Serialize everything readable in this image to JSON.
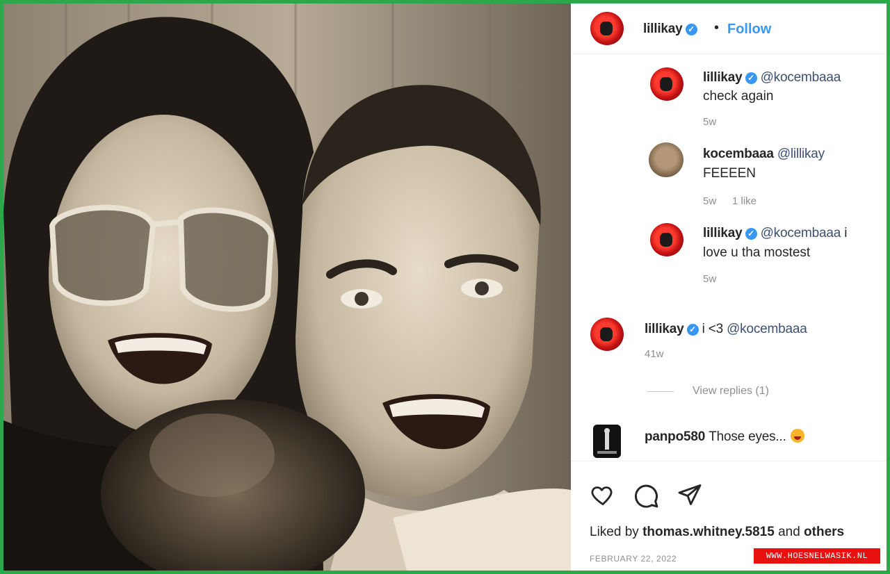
{
  "header": {
    "username": "lillikay",
    "separator": "•",
    "follow_label": "Follow"
  },
  "comments": [
    {
      "username": "lillikay",
      "verified": true,
      "mention": "@kocembaaa",
      "text": "check again",
      "time": "5w",
      "likes": ""
    },
    {
      "username": "kocembaaa",
      "verified": false,
      "mention": "@lillikay",
      "text": "FEEEEN",
      "time": "5w",
      "likes": "1 like"
    },
    {
      "username": "lillikay",
      "verified": true,
      "mention": "@kocembaaa",
      "text_line1_suffix": "i",
      "text": "love u tha mostest",
      "time": "5w",
      "likes": ""
    }
  ],
  "main_comment": {
    "username": "lillikay",
    "verified": true,
    "text": "i <3",
    "mention": "@kocembaaa",
    "time": "41w"
  },
  "view_replies": "View replies (1)",
  "last_comment": {
    "username": "panpo580",
    "text": "Those eyes..."
  },
  "actions": {
    "like_icon": "heart-icon",
    "comment_icon": "comment-icon",
    "share_icon": "share-icon"
  },
  "likes": {
    "prefix": "Liked by",
    "user": "thomas.whitney.5815",
    "middle": "and",
    "suffix": "others"
  },
  "date": "FEBRUARY 22, 2022",
  "watermark": "WWW.HOESNELWASIK.NL",
  "colors": {
    "border": "#2aa84a",
    "accent": "#3897f0",
    "watermark_bg": "#e8110f"
  }
}
